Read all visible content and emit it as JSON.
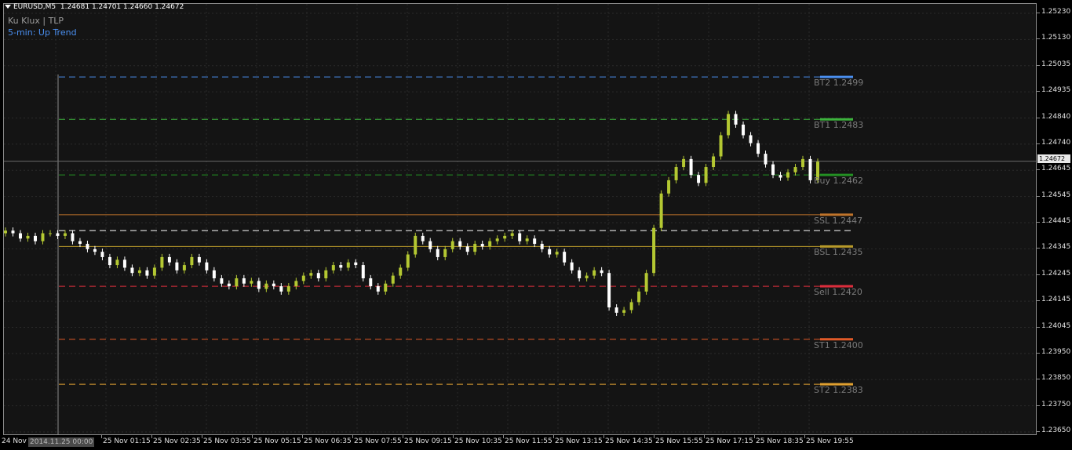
{
  "header": {
    "symbol": "EURUSD,M5",
    "ohlc": "1.24681 1.24701 1.24660 1.24672"
  },
  "indicators": {
    "line1": "Ku Klux | TLP",
    "line2": "5-min: Up Trend"
  },
  "colors": {
    "background": "#141414",
    "bull": "#b4c832",
    "bear": "#ffffff",
    "line1_color": "#9a9a9a",
    "line2_color": "#4a8ff0"
  },
  "current_price": "1.24672",
  "cursor_time": "2014.11.25 00:00",
  "first_time_label": "24 Nov",
  "time_labels": [
    "25 Nov 01:15",
    "25 Nov 02:35",
    "25 Nov 03:55",
    "25 Nov 05:15",
    "25 Nov 06:35",
    "25 Nov 07:55",
    "25 Nov 09:15",
    "25 Nov 10:35",
    "25 Nov 11:55",
    "25 Nov 13:15",
    "25 Nov 14:35",
    "25 Nov 15:55",
    "25 Nov 17:15",
    "25 Nov 18:35",
    "25 Nov 19:55"
  ],
  "price_ticks": [
    "1.25230",
    "1.25130",
    "1.25035",
    "1.24935",
    "1.24840",
    "1.24740",
    "1.24645",
    "1.24545",
    "1.24445",
    "1.24345",
    "1.24245",
    "1.24145",
    "1.24045",
    "1.23950",
    "1.23850",
    "1.23750",
    "1.23650"
  ],
  "levels": [
    {
      "name": "BT2",
      "label": "BT2 1.2499",
      "price": 1.2499,
      "color": "#4a8ff0",
      "dash": "dashed"
    },
    {
      "name": "BT1",
      "label": "BT1 1.2483",
      "price": 1.2483,
      "color": "#3cb43c",
      "dash": "dashed"
    },
    {
      "name": "Buy",
      "label": "Buy 1.2462",
      "price": 1.2462,
      "color": "#239123",
      "dash": "dashed"
    },
    {
      "name": "SSL",
      "label": "SSL 1.2447",
      "price": 1.2447,
      "color": "#c0742a",
      "dash": "solid"
    },
    {
      "name": "entry",
      "label": "",
      "price": 1.2441,
      "color": "#ffffff",
      "dash": "dashed"
    },
    {
      "name": "BSL",
      "label": "BSL 1.2435",
      "price": 1.2435,
      "color": "#b89a2a",
      "dash": "solid"
    },
    {
      "name": "Sell",
      "label": "Sell 1.2420",
      "price": 1.242,
      "color": "#dc2d3c",
      "dash": "dashed"
    },
    {
      "name": "ST1",
      "label": "ST1 1.2400",
      "price": 1.24,
      "color": "#e05a28",
      "dash": "dashed"
    },
    {
      "name": "ST2",
      "label": "ST2 1.2383",
      "price": 1.2383,
      "color": "#e0a030",
      "dash": "dashed"
    }
  ],
  "chart_data": {
    "type": "candlestick",
    "symbol": "EURUSD",
    "timeframe": "M5",
    "ylim": [
      1.2365,
      1.2526
    ],
    "series": [
      {
        "values": [
          1.2441,
          1.244,
          1.2438,
          1.2439,
          1.2437,
          1.244,
          1.244,
          1.2439,
          1.244,
          1.2437,
          1.2436,
          1.2434,
          1.2433,
          1.2431,
          1.2428,
          1.243,
          1.2427,
          1.2425,
          1.2426,
          1.2424,
          1.2427,
          1.2431,
          1.2429,
          1.2426,
          1.2428,
          1.2431,
          1.2429,
          1.2426,
          1.2423,
          1.2421,
          1.242,
          1.2423,
          1.2421,
          1.2422,
          1.2419,
          1.2421,
          1.242,
          1.2418,
          1.242,
          1.2422,
          1.2424,
          1.2425,
          1.2423,
          1.2426,
          1.2428,
          1.2427,
          1.2429,
          1.2428,
          1.2423,
          1.242,
          1.2418,
          1.2421,
          1.2424,
          1.2427,
          1.2432,
          1.2439,
          1.2437,
          1.2434,
          1.2431,
          1.2434,
          1.2437,
          1.2435,
          1.2433,
          1.2436,
          1.2435,
          1.2437,
          1.2438,
          1.2439,
          1.244,
          1.2437,
          1.2438,
          1.2436,
          1.2434,
          1.2432,
          1.2433,
          1.2429,
          1.2426,
          1.2423,
          1.2424,
          1.2426,
          1.2425,
          1.2412,
          1.241,
          1.2411,
          1.2414,
          1.2418,
          1.2425,
          1.2442,
          1.2455,
          1.246,
          1.2465,
          1.2468,
          1.2462,
          1.2459,
          1.2465,
          1.2469,
          1.2477,
          1.2485,
          1.2481,
          1.2477,
          1.2474,
          1.247,
          1.2466,
          1.2462,
          1.2461,
          1.2463,
          1.2465,
          1.2468,
          1.246,
          1.2467
        ]
      }
    ]
  }
}
